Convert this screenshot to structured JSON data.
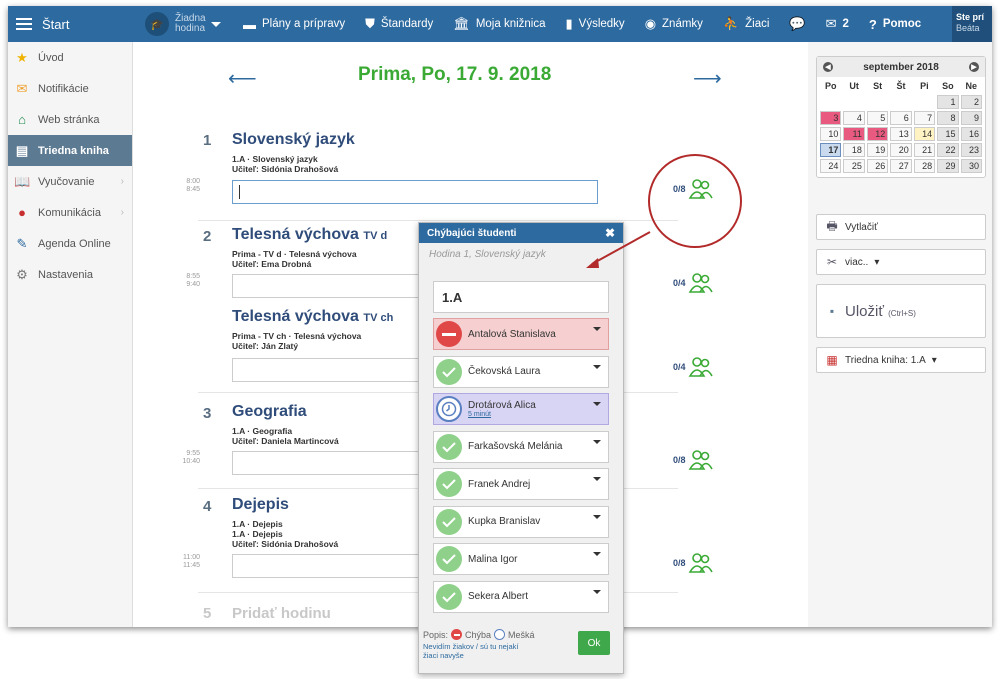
{
  "topbar": {
    "start": "Štart",
    "hodina": "Žiadna hodina",
    "nav": [
      "Plány a prípravy",
      "Štandardy",
      "Moja knižnica",
      "Výsledky",
      "Známky",
      "Žiaci"
    ],
    "messages_count": "2",
    "help": "Pomoc",
    "user_line1": "Ste prí",
    "user_line2": "Beáta"
  },
  "sidebar": {
    "items": [
      {
        "label": "Úvod",
        "icon": "star-icon"
      },
      {
        "label": "Notifikácie",
        "icon": "envelope-icon"
      },
      {
        "label": "Web stránka",
        "icon": "home-icon"
      },
      {
        "label": "Triedna kniha",
        "icon": "book-icon"
      },
      {
        "label": "Vyučovanie",
        "icon": "open-book-icon"
      },
      {
        "label": "Komunikácia",
        "icon": "chat-icon"
      },
      {
        "label": "Agenda Online",
        "icon": "pencil-icon"
      },
      {
        "label": "Nastavenia",
        "icon": "gear-icon"
      }
    ]
  },
  "main": {
    "date": "Prima, Po, 17. 9. 2018",
    "lessons": [
      {
        "num": "1",
        "title": "Slovenský jazyk",
        "tag": "",
        "sub1": "1.A · Slovenský jazyk",
        "sub2": "Učiteľ:  Sidónia Drahošová",
        "sub3": "",
        "t1": "8:00",
        "t2": "8:45",
        "count": "0/8"
      },
      {
        "num": "2",
        "title": "Telesná výchova",
        "tag": "TV d",
        "sub1": "Prima - TV d · Telesná výchova",
        "sub2": "Učiteľ:  Ema Drobná",
        "sub3": "",
        "t1": "8:55",
        "t2": "9:40",
        "count": "0/4"
      },
      {
        "num": "",
        "title": "Telesná výchova",
        "tag": "TV ch",
        "sub1": "Prima - TV ch · Telesná výchova",
        "sub2": "Učiteľ:  Ján Zlatý",
        "sub3": "",
        "t1": "",
        "t2": "",
        "count": "0/4"
      },
      {
        "num": "3",
        "title": "Geografia",
        "tag": "",
        "sub1": "1.A · Geografia",
        "sub2": "Učiteľ:  Daniela Martincová",
        "sub3": "",
        "t1": "9:55",
        "t2": "10:40",
        "count": "0/8"
      },
      {
        "num": "4",
        "title": "Dejepis",
        "tag": "",
        "sub1": "1.A · Dejepis",
        "sub2": "1.A · Dejepis",
        "sub3": "Učiteľ:  Sidónia Drahošová",
        "t1": "11:00",
        "t2": "11:45",
        "count": "0/8"
      }
    ],
    "add_num": "5",
    "add_label": "Pridať hodinu"
  },
  "calendar": {
    "month": "september 2018",
    "dow": [
      "Po",
      "Ut",
      "St",
      "Št",
      "Pi",
      "So",
      "Ne"
    ]
  },
  "right": {
    "print": "Vytlačiť",
    "more": "viac..",
    "save": "Uložiť",
    "save_hint": "(Ctrl+S)",
    "book": "Triedna kniha: 1.A"
  },
  "popup": {
    "title": "Chýbajúci študenti",
    "subtitle": "Hodina 1, Slovenský jazyk",
    "class": "1.A",
    "students": [
      {
        "name": "Antalová Stanislava",
        "status": "absent",
        "note": ""
      },
      {
        "name": "Čekovská Laura",
        "status": "present",
        "note": ""
      },
      {
        "name": "Drotárová Alica",
        "status": "late",
        "note": "5 minút"
      },
      {
        "name": "Farkašovská Melánia",
        "status": "present",
        "note": ""
      },
      {
        "name": "Franek Andrej",
        "status": "present",
        "note": ""
      },
      {
        "name": "Kupka Branislav",
        "status": "present",
        "note": ""
      },
      {
        "name": "Malina Igor",
        "status": "present",
        "note": ""
      },
      {
        "name": "Sekera Albert",
        "status": "present",
        "note": ""
      }
    ],
    "legend_label": "Popis:",
    "legend_absent": "Chýba",
    "legend_late": "Mešká",
    "no_students": "Nevidím žiakov / sú tu nejakí žiaci navyše",
    "ok": "Ok"
  },
  "colors": {
    "topbar": "#2d6a9f",
    "accent_green": "#3aaa35",
    "absent": "#e04848",
    "late": "#5a7fc0",
    "calendar_red": "#e85a7f"
  }
}
